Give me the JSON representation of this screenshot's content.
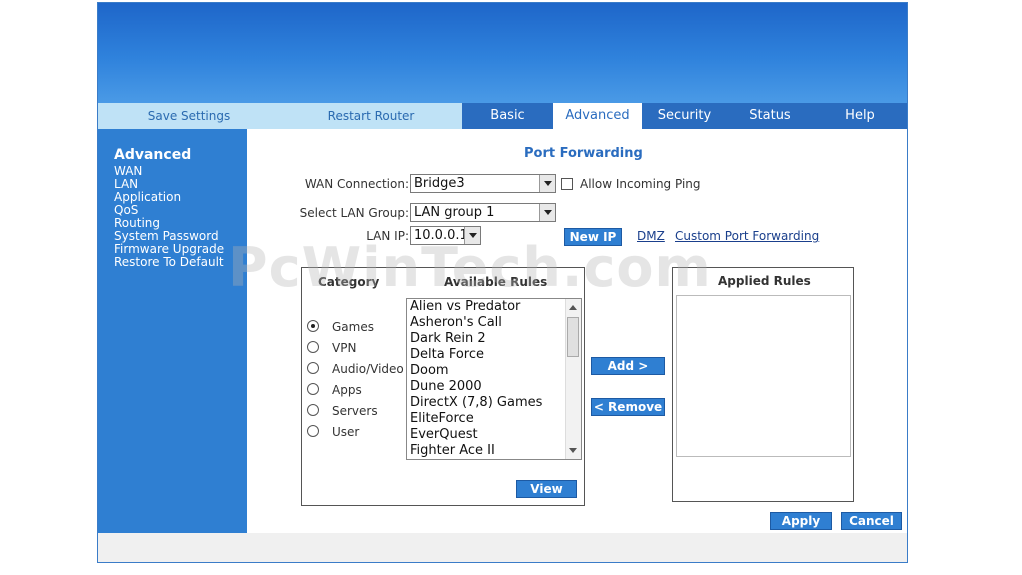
{
  "menubar": {
    "save_settings": "Save Settings",
    "restart_router": "Restart Router"
  },
  "tabs": [
    {
      "label": "Basic",
      "active": false
    },
    {
      "label": "Advanced",
      "active": true
    },
    {
      "label": "Security",
      "active": false
    },
    {
      "label": "Status",
      "active": false
    },
    {
      "label": "Help",
      "active": false
    }
  ],
  "sidebar": {
    "title": "Advanced",
    "items": [
      "WAN",
      "LAN",
      "Application",
      "QoS",
      "Routing",
      "System Password",
      "Firmware Upgrade",
      "Restore To Default"
    ]
  },
  "page": {
    "heading": "Port Forwarding",
    "wan_connection_label": "WAN Connection:",
    "wan_connection_value": "Bridge3",
    "allow_ping_label": "Allow Incoming Ping",
    "lan_group_label": "Select LAN Group:",
    "lan_group_value": "LAN group 1",
    "lan_ip_label": "LAN IP:",
    "lan_ip_value": "10.0.0.1",
    "new_ip_button": "New IP",
    "dmz_link": "DMZ",
    "custom_link": "Custom Port Forwarding"
  },
  "rules": {
    "category_title": "Category",
    "available_title": "Available Rules",
    "applied_title": "Applied Rules",
    "categories": [
      {
        "label": "Games",
        "selected": true
      },
      {
        "label": "VPN",
        "selected": false
      },
      {
        "label": "Audio/Video",
        "selected": false
      },
      {
        "label": "Apps",
        "selected": false
      },
      {
        "label": "Servers",
        "selected": false
      },
      {
        "label": "User",
        "selected": false
      }
    ],
    "available": [
      "Alien vs Predator",
      "Asheron's Call",
      "Dark Rein 2",
      "Delta Force",
      "Doom",
      "Dune 2000",
      "DirectX (7,8) Games",
      "EliteForce",
      "EverQuest",
      "Fighter Ace II"
    ],
    "applied": [],
    "view_button": "View",
    "add_button": "Add >",
    "remove_button": "< Remove"
  },
  "actions": {
    "apply": "Apply",
    "cancel": "Cancel"
  },
  "watermark": "PcWinTech.com",
  "colors": {
    "banner": "#2f82dc",
    "nav_blue": "#2a6cbf",
    "sidebar": "#2f7fd2",
    "menubar": "#bfe2f6"
  }
}
